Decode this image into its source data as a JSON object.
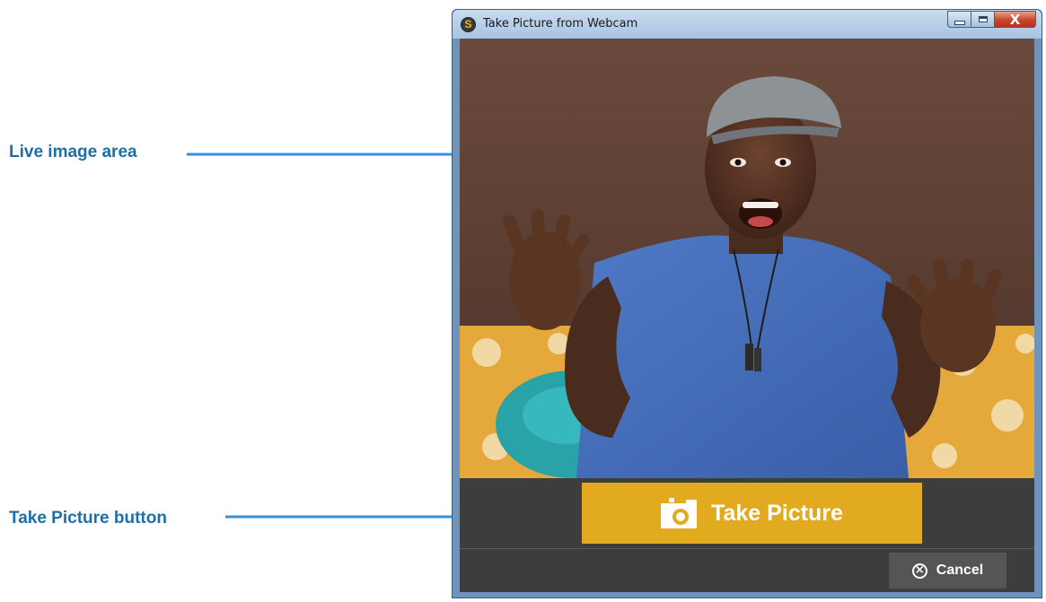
{
  "callouts": {
    "live_image": "Live image area",
    "take_picture": "Take Picture button"
  },
  "window": {
    "title": "Take Picture from Webcam",
    "app_icon_letter": "S",
    "close_glyph": "X"
  },
  "buttons": {
    "take_picture": "Take Picture",
    "cancel": "Cancel",
    "cancel_glyph": "×"
  },
  "icons": {
    "app": "app-logo-icon",
    "take_picture": "camera-icon",
    "cancel": "circle-x-icon"
  },
  "colors": {
    "callout_text": "#1d6fa8",
    "arrow": "#3a8fd8",
    "take_button": "#e2ab1f",
    "panel_bg": "#3d3d3d"
  }
}
